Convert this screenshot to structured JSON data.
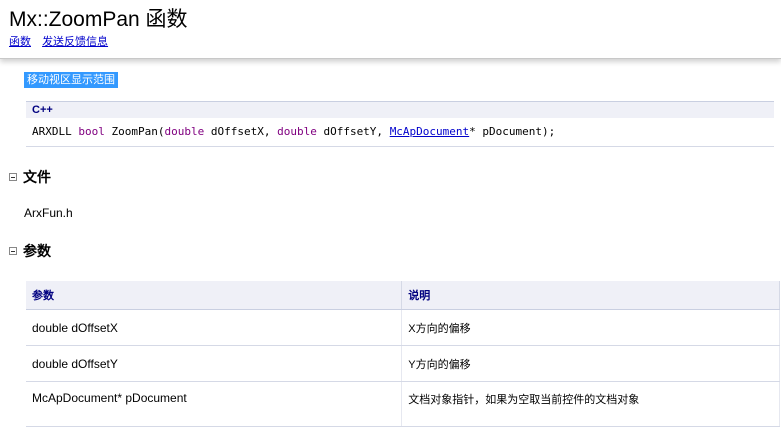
{
  "header": {
    "title": "Mx::ZoomPan 函数",
    "links": [
      "函数",
      "发送反馈信息"
    ]
  },
  "summary": "移动视区显示范围",
  "syntax": {
    "language": "C++",
    "tokens": {
      "prefix": "ARXDLL ",
      "ret_type": "bool",
      "func": " ZoomPan(",
      "type1": "double",
      "arg1": " dOffsetX, ",
      "type2": "double",
      "arg2": " dOffsetY, ",
      "type3": "McApDocument",
      "arg3": "* pDocument);"
    }
  },
  "sections": {
    "file_heading": "文件",
    "file_value": "ArxFun.h",
    "params_heading": "参数"
  },
  "params_table": {
    "headers": [
      "参数",
      "说明"
    ],
    "rows": [
      {
        "name": "double dOffsetX",
        "desc": "X方向的偏移"
      },
      {
        "name": "double dOffsetY",
        "desc": "Y方向的偏移"
      },
      {
        "name": "McApDocument* pDocument",
        "desc": "文档对象指针，如果为空取当前控件的文档对象"
      }
    ]
  },
  "colors": {
    "link": "#0000cc",
    "keyword": "#800080",
    "summary_bg": "#3399ff",
    "table_header_bg": "#eff0f7"
  }
}
